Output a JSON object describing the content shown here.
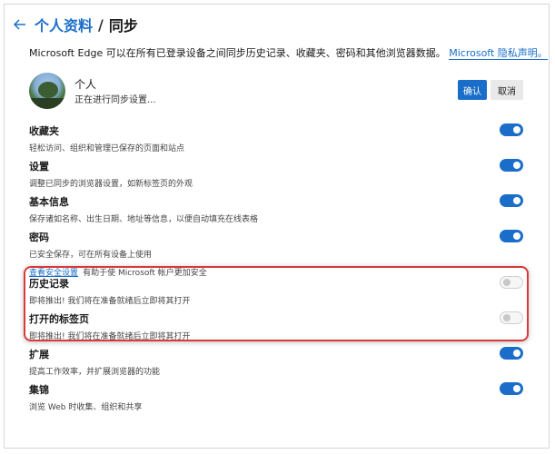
{
  "header": {
    "back_icon": "arrow-left-icon",
    "crumb_parent": "个人资料",
    "separator": "/",
    "crumb_current": "同步"
  },
  "description": {
    "text": "Microsoft Edge 可以在所有已登录设备之间同步历史记录、收藏夹、密码和其他浏览器数据。",
    "link": "Microsoft 隐私声明。"
  },
  "profile": {
    "name": "个人",
    "status": "正在进行同步设置...",
    "confirm_label": "确认",
    "cancel_label": "取消"
  },
  "sync_items": [
    {
      "title": "收藏夹",
      "subtitle": "轻松访问、组织和管理已保存的页面和站点",
      "enabled": true
    },
    {
      "title": "设置",
      "subtitle": "调整已同步的浏览器设置，如新标签页的外观",
      "enabled": true
    },
    {
      "title": "基本信息",
      "subtitle": "保存诸如名称、出生日期、地址等信息，以便自动填充在线表格",
      "enabled": true
    },
    {
      "title": "密码",
      "subtitle": "已安全保存，可在所有设备上使用",
      "link": "查看安全设置",
      "link_rest": "有助于使 Microsoft 帐户更加安全",
      "enabled": true
    },
    {
      "title": "历史记录",
      "subtitle": "即将推出! 我们将在准备就绪后立即将其打开",
      "enabled": false
    },
    {
      "title": "打开的标签页",
      "subtitle": "即将推出! 我们将在准备就绪后立即将其打开",
      "enabled": false
    },
    {
      "title": "扩展",
      "subtitle": "提高工作效率，并扩展浏览器的功能",
      "enabled": true
    },
    {
      "title": "集锦",
      "subtitle": "浏览 Web 时收集、组织和共享",
      "enabled": true
    }
  ],
  "colors": {
    "accent": "#1a6ec9",
    "highlight_border": "#d83a3a"
  }
}
